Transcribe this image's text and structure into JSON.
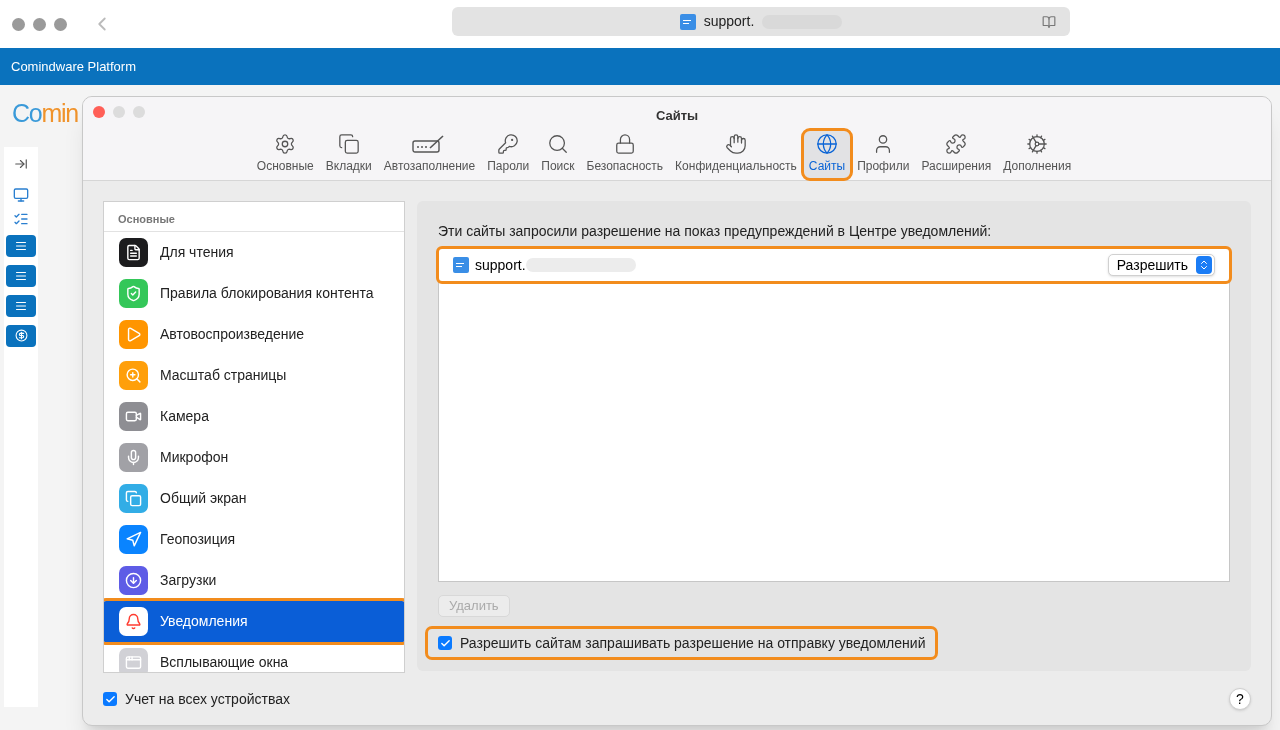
{
  "browser": {
    "url": "support.",
    "app_bar_title": "Comindware Platform",
    "logo_parts": [
      "Co",
      "min"
    ]
  },
  "dialog": {
    "title": "Сайты",
    "toolbar": [
      {
        "label": "Основные",
        "kind": "gear",
        "selected": false,
        "highlighted": false
      },
      {
        "label": "Вкладки",
        "kind": "tabs",
        "selected": false,
        "highlighted": false
      },
      {
        "label": "Автозаполнение",
        "kind": "autofill",
        "selected": false,
        "highlighted": false
      },
      {
        "label": "Пароли",
        "kind": "key",
        "selected": false,
        "highlighted": false
      },
      {
        "label": "Поиск",
        "kind": "search",
        "selected": false,
        "highlighted": false
      },
      {
        "label": "Безопасность",
        "kind": "lock",
        "selected": false,
        "highlighted": false
      },
      {
        "label": "Конфиденциальность",
        "kind": "hand",
        "selected": false,
        "highlighted": false
      },
      {
        "label": "Сайты",
        "kind": "globe",
        "selected": true,
        "highlighted": true
      },
      {
        "label": "Профили",
        "kind": "user",
        "selected": false,
        "highlighted": false
      },
      {
        "label": "Расширения",
        "kind": "puzzle",
        "selected": false,
        "highlighted": false
      },
      {
        "label": "Дополнения",
        "kind": "gears",
        "selected": false,
        "highlighted": false
      }
    ],
    "sidebar": {
      "section": "Основные",
      "items": [
        {
          "label": "Для чтения",
          "kind": "reader",
          "selected": false,
          "highlighted": false
        },
        {
          "label": "Правила блокирования контента",
          "kind": "shield",
          "selected": false,
          "highlighted": false
        },
        {
          "label": "Автовоспроизведение",
          "kind": "play",
          "selected": false,
          "highlighted": false
        },
        {
          "label": "Масштаб страницы",
          "kind": "zoom",
          "selected": false,
          "highlighted": false
        },
        {
          "label": "Камера",
          "kind": "camera",
          "selected": false,
          "highlighted": false
        },
        {
          "label": "Микрофон",
          "kind": "mic",
          "selected": false,
          "highlighted": false
        },
        {
          "label": "Общий экран",
          "kind": "screen",
          "selected": false,
          "highlighted": false
        },
        {
          "label": "Геопозиция",
          "kind": "location",
          "selected": false,
          "highlighted": false
        },
        {
          "label": "Загрузки",
          "kind": "download",
          "selected": false,
          "highlighted": false
        },
        {
          "label": "Уведомления",
          "kind": "bell",
          "selected": true,
          "highlighted": true
        },
        {
          "label": "Всплывающие окна",
          "kind": "popup",
          "selected": false,
          "highlighted": false
        }
      ]
    },
    "panel": {
      "description": "Эти сайты запросили разрешение на показ предупреждений в Центре уведомлений:",
      "sites": [
        {
          "name": "support.",
          "permission": "Разрешить",
          "highlighted": true
        }
      ],
      "remove_button": {
        "label": "Удалить",
        "disabled": true
      },
      "allow_requests": {
        "label": "Разрешить сайтам запрашивать разрешение на отправку уведомлений",
        "checked": true,
        "highlighted": true
      }
    },
    "sync": {
      "label": "Учет на всех устройствах",
      "checked": true
    },
    "help": "?"
  }
}
